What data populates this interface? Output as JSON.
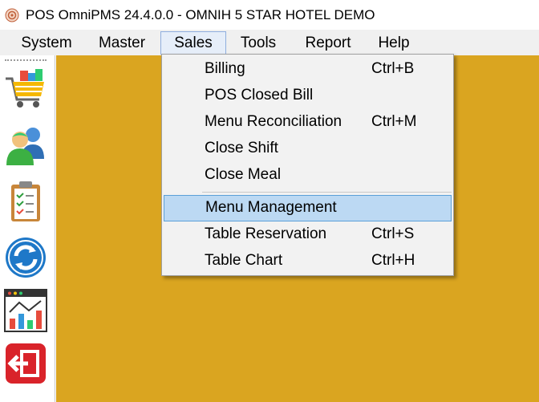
{
  "window": {
    "title": "POS OmniPMS 24.4.0.0 - OMNIH 5 STAR HOTEL DEMO"
  },
  "menubar": {
    "items": [
      {
        "label": "System"
      },
      {
        "label": "Master"
      },
      {
        "label": "Sales",
        "active": true
      },
      {
        "label": "Tools"
      },
      {
        "label": "Report"
      },
      {
        "label": "Help"
      }
    ]
  },
  "sales_menu": {
    "items": [
      {
        "label": "Billing",
        "shortcut": "Ctrl+B"
      },
      {
        "label": "POS Closed Bill",
        "shortcut": ""
      },
      {
        "label": "Menu Reconciliation",
        "shortcut": "Ctrl+M"
      },
      {
        "label": "Close Shift",
        "shortcut": ""
      },
      {
        "label": "Close Meal",
        "shortcut": ""
      },
      {
        "label": "Menu Management",
        "shortcut": "",
        "highlighted": true
      },
      {
        "label": "Table Reservation",
        "shortcut": "Ctrl+S"
      },
      {
        "label": "Table Chart",
        "shortcut": "Ctrl+H"
      }
    ]
  },
  "toolbar": {
    "icons": [
      "shopping-cart-icon",
      "users-icon",
      "clipboard-icon",
      "refresh-icon",
      "analytics-icon",
      "exit-icon"
    ]
  },
  "colors": {
    "workspace": "#daa520",
    "highlight": "#bcd9f3",
    "highlight_border": "#5ba0d8"
  }
}
